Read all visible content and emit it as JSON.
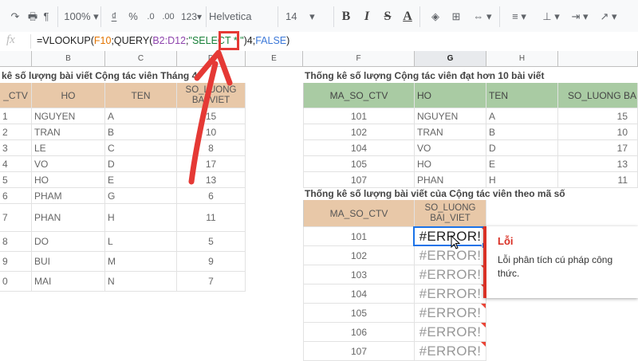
{
  "toolbar": {
    "zoom": "100%",
    "currency": "₫",
    "percent": "%",
    "dec_less": ".0",
    "dec_more": ".00",
    "format_more": "123",
    "font": "Helvetica",
    "font_size": "14",
    "bold": "B",
    "italic": "I",
    "strike": "S",
    "text_color": "A"
  },
  "formula_bar": {
    "fx": "fx",
    "parts": [
      "=VLOOKUP(",
      "F10",
      ";QUERY(",
      "B2:D12",
      ";",
      "\"SELECT * \"",
      ")4;",
      "FALSE",
      ")"
    ]
  },
  "columns": [
    "B",
    "C",
    "D",
    "E",
    "F",
    "G",
    "H"
  ],
  "left_table": {
    "title": "kê số lượng bài viết Cộng tác viên Tháng 4",
    "headers": [
      "_CTV",
      "HO",
      "TEN",
      "SO_LUONG BAI VIET"
    ],
    "rows": [
      [
        "1",
        "NGUYEN",
        "A",
        "15"
      ],
      [
        "2",
        "TRAN",
        "B",
        "10"
      ],
      [
        "3",
        "LE",
        "C",
        "8"
      ],
      [
        "4",
        "VO",
        "D",
        "17"
      ],
      [
        "5",
        "HO",
        "E",
        "13"
      ],
      [
        "6",
        "PHAM",
        "G",
        "6"
      ],
      [
        "7",
        "PHAN",
        "H",
        "11"
      ],
      [
        "8",
        "DO",
        "L",
        "5"
      ],
      [
        "9",
        "BUI",
        "M",
        "9"
      ],
      [
        "0",
        "MAI",
        "N",
        "7"
      ]
    ]
  },
  "right_table": {
    "title": "Thống kê số lượng Cộng tác viên đạt hơn 10 bài viết",
    "headers": [
      "MA_SO_CTV",
      "HO",
      "TEN",
      "SO_LUONG BA"
    ],
    "rows": [
      [
        "101",
        "NGUYEN",
        "A",
        "15"
      ],
      [
        "102",
        "TRAN",
        "B",
        "10"
      ],
      [
        "104",
        "VO",
        "D",
        "17"
      ],
      [
        "105",
        "HO",
        "E",
        "13"
      ],
      [
        "107",
        "PHAN",
        "H",
        "11"
      ]
    ]
  },
  "lookup_table": {
    "title": "Thống kê số lượng bài viết của Cộng tác viên theo mã số",
    "headers": [
      "MA_SO_CTV",
      "SO_LUONG BAI_VIET"
    ],
    "rows": [
      [
        "101",
        "#ERROR!"
      ],
      [
        "102",
        "#ERROR!"
      ],
      [
        "103",
        "#ERROR!"
      ],
      [
        "104",
        "#ERROR!"
      ],
      [
        "105",
        "#ERROR!"
      ],
      [
        "106",
        "#ERROR!"
      ],
      [
        "107",
        "#ERROR!"
      ]
    ]
  },
  "error_popup": {
    "title": "Lỗi",
    "message": "Lỗi phân tích cú pháp công thức."
  },
  "colors": {
    "header_tan": "#e8c8a8",
    "header_green": "#a9cba3",
    "error_red": "#d93025",
    "selection_blue": "#1a73e8",
    "annotation_red": "#e53935"
  }
}
